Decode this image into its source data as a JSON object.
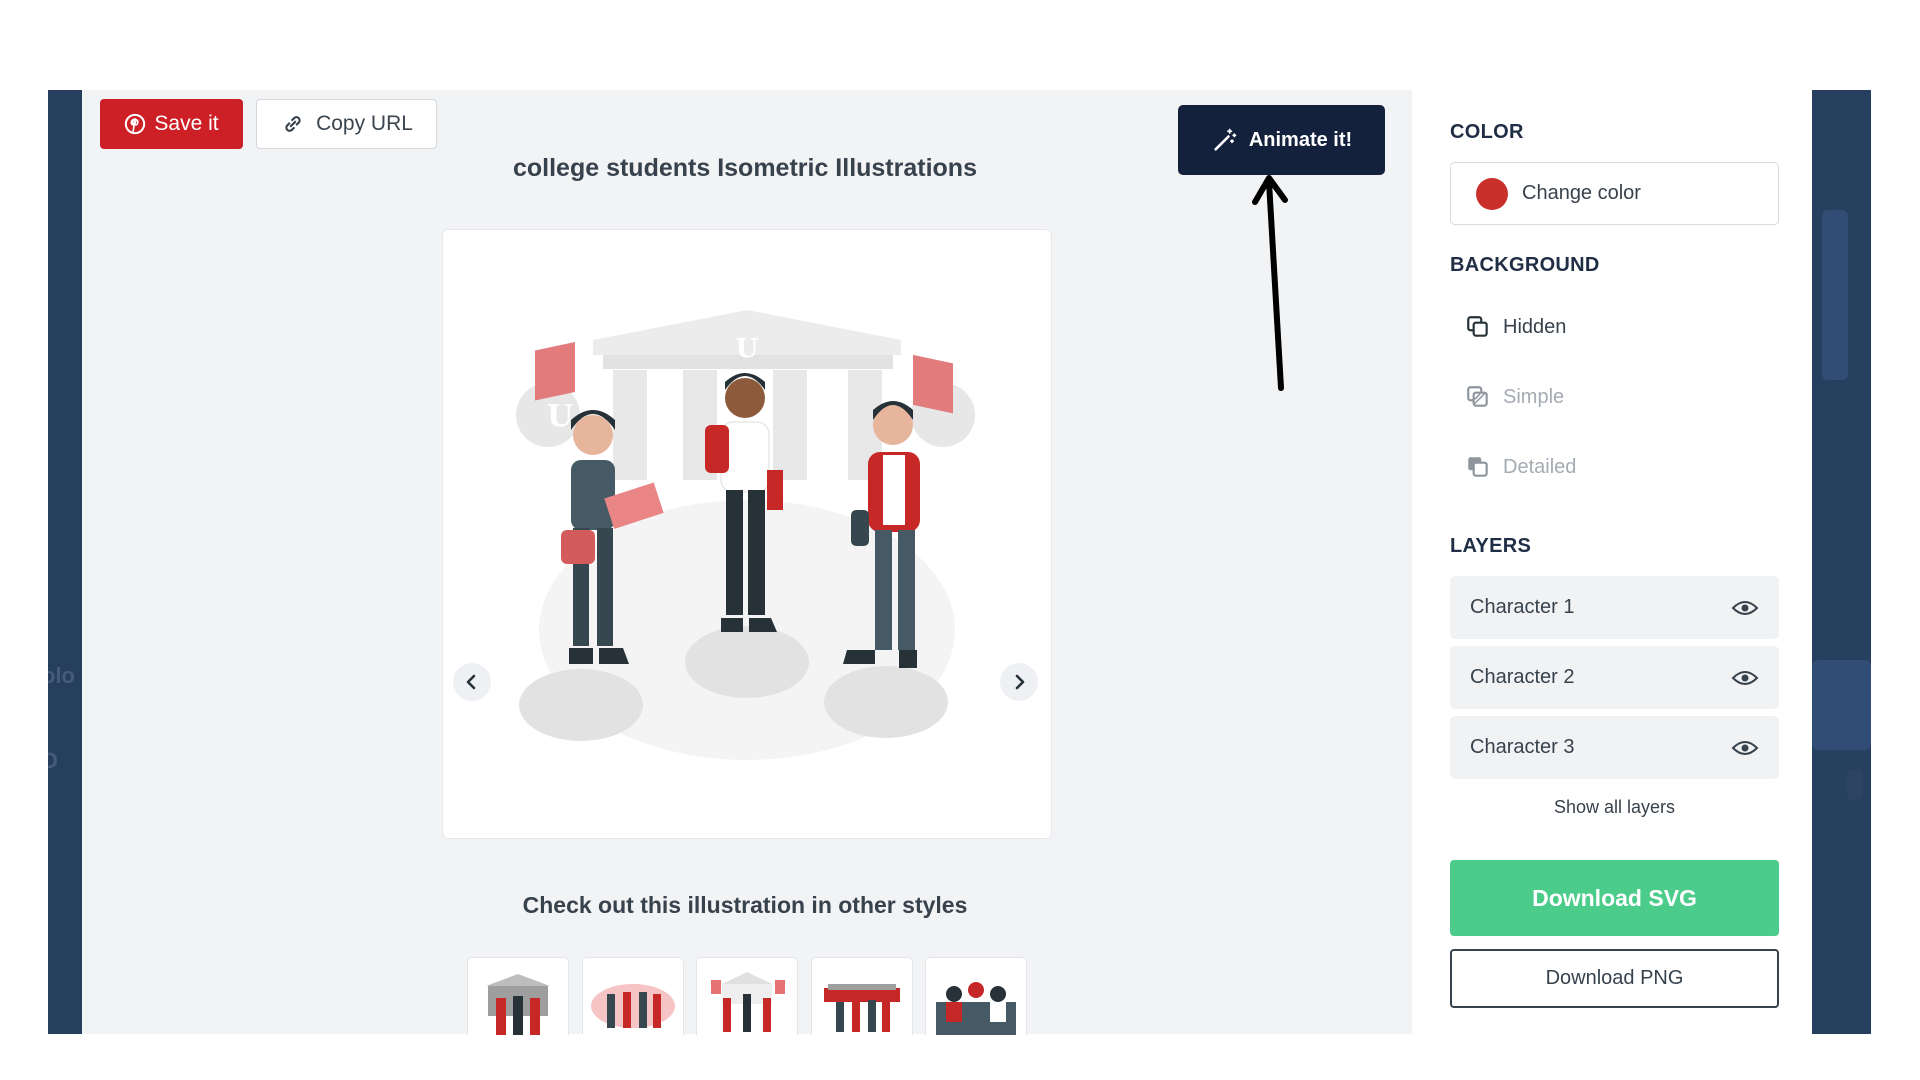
{
  "toolbar": {
    "save_label": "Save it",
    "copy_url_label": "Copy URL",
    "animate_label": "Animate it!"
  },
  "main": {
    "title": "college students Isometric Illustrations",
    "other_styles_heading": "Check out this illustration in other styles",
    "thumbnails": [
      "thumbnail-style-1",
      "thumbnail-style-2",
      "thumbnail-style-3",
      "thumbnail-style-4",
      "thumbnail-style-5"
    ]
  },
  "sidebar": {
    "color": {
      "label": "COLOR",
      "change_color_label": "Change color",
      "current_color": "#c9302c"
    },
    "background": {
      "label": "BACKGROUND",
      "options": [
        {
          "label": "Hidden",
          "icon": "layers-hidden-icon",
          "active": true
        },
        {
          "label": "Simple",
          "icon": "layers-simple-icon",
          "active": false
        },
        {
          "label": "Detailed",
          "icon": "layers-detailed-icon",
          "active": false
        }
      ]
    },
    "layers": {
      "label": "LAYERS",
      "items": [
        {
          "label": "Character 1",
          "icon": "eye-icon"
        },
        {
          "label": "Character 2",
          "icon": "eye-icon"
        },
        {
          "label": "Character 3",
          "icon": "eye-icon"
        }
      ],
      "show_all_label": "Show all layers"
    },
    "download_svg_label": "Download SVG",
    "download_png_label": "Download PNG"
  },
  "colors": {
    "brand_red": "#cd2026",
    "navy": "#14213d",
    "green": "#4bcc8b",
    "panel_bg": "#f2f3f5"
  },
  "backdrop": {
    "left_ghost_texts": [
      "olo",
      "D"
    ]
  }
}
